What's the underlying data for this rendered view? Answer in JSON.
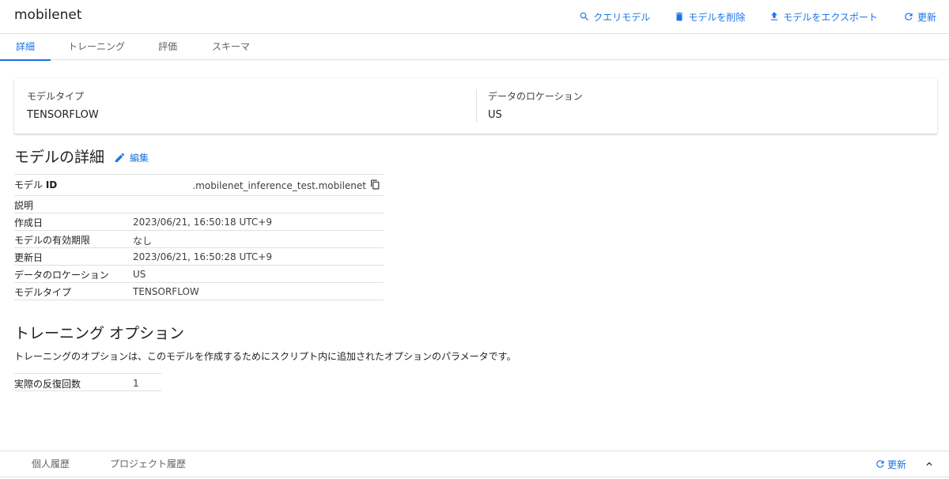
{
  "header": {
    "title": "mobilenet",
    "actions": {
      "query": "クエリモデル",
      "delete": "モデルを削除",
      "export": "モデルをエクスポート",
      "refresh": "更新"
    }
  },
  "tabs": [
    {
      "label": "詳細",
      "active": true
    },
    {
      "label": "トレーニング",
      "active": false
    },
    {
      "label": "評価",
      "active": false
    },
    {
      "label": "スキーマ",
      "active": false
    }
  ],
  "card": {
    "model_type_label": "モデルタイプ",
    "model_type_value": "TENSORFLOW",
    "location_label": "データのロケーション",
    "location_value": "US"
  },
  "details": {
    "title": "モデルの詳細",
    "edit_label": "編集",
    "model_id_key": "モデル",
    "model_id_key_bold": "ID",
    "model_id_value": ".mobilenet_inference_test.mobilenet",
    "rows": [
      {
        "key": "説明",
        "value": ""
      },
      {
        "key": "作成日",
        "value": "2023/06/21, 16:50:18 UTC+9"
      },
      {
        "key": "モデルの有効期限",
        "value": "なし"
      },
      {
        "key": "更新日",
        "value": "2023/06/21, 16:50:28 UTC+9"
      },
      {
        "key": "データのロケーション",
        "value": "US"
      },
      {
        "key": "モデルタイプ",
        "value": "TENSORFLOW"
      }
    ]
  },
  "training": {
    "title": "トレーニング オプション",
    "description": "トレーニングのオプションは、このモデルを作成するためにスクリプト内に追加されたオプションのパラメータです。",
    "rows": [
      {
        "key": "実際の反復回数",
        "value": "1"
      }
    ]
  },
  "footer": {
    "tabs": [
      "個人履歴",
      "プロジェクト履歴"
    ],
    "refresh": "更新"
  },
  "colors": {
    "accent": "#1a73e8",
    "text": "#202124",
    "divider": "#e0e0e0"
  }
}
